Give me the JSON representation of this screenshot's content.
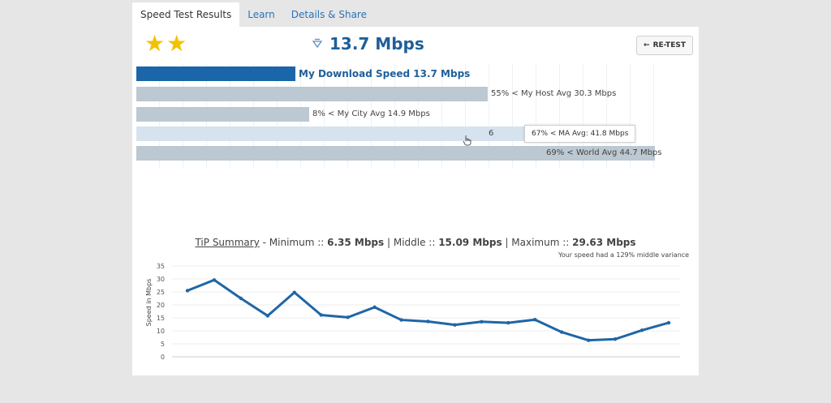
{
  "tabs": [
    {
      "label": "Speed Test Results",
      "active": true
    },
    {
      "label": "Learn",
      "active": false
    },
    {
      "label": "Details & Share",
      "active": false
    }
  ],
  "stars": {
    "count": 2,
    "glyph": "★",
    "color": "#f2c200"
  },
  "header": {
    "speed": "13.7 Mbps",
    "download_icon": "download-arrow-icon",
    "retest_arrow": "←",
    "retest_label": "RE-TEST"
  },
  "bars": [
    {
      "label": "My Download Speed 13.7 Mbps",
      "value": 13.7,
      "color": "#1a66a8",
      "primary": true
    },
    {
      "label": "55% < My Host Avg 30.3 Mbps",
      "value": 30.3,
      "color": "#bcc8d2"
    },
    {
      "label": "8% < My City Avg 14.9 Mbps",
      "value": 14.9,
      "color": "#bcc8d2"
    },
    {
      "label": "6",
      "value": 41.8,
      "color": "#d6e3ee"
    },
    {
      "label": "69% < World Avg 44.7 Mbps",
      "value": 44.7,
      "color": "#bcc8d2"
    }
  ],
  "tooltip": "67% < MA Avg: 41.8 Mbps",
  "summary": {
    "tip_label": "TiP Summary",
    "min_label": " - Minimum :: ",
    "min_value": "6.35 Mbps",
    "mid_label": " | Middle :: ",
    "mid_value": "15.09 Mbps",
    "max_label": " | Maximum :: ",
    "max_value": "29.63 Mbps",
    "variance": "Your speed had a 129% middle variance"
  },
  "chart_data": {
    "type": "line",
    "ylabel": "Speed in Mbps",
    "ylim": [
      0,
      35
    ],
    "yticks": [
      0,
      5,
      10,
      15,
      20,
      25,
      30,
      35
    ],
    "x": [
      1,
      2,
      3,
      4,
      5,
      6,
      7,
      8,
      9,
      10,
      11,
      12,
      13,
      14,
      15,
      16,
      17,
      18,
      19
    ],
    "series": [
      {
        "values": [
          25.5,
          29.6,
          22.5,
          15.8,
          24.8,
          16.1,
          15.2,
          19.1,
          14.2,
          13.6,
          12.3,
          13.5,
          13.1,
          14.3,
          9.5,
          6.35,
          6.8,
          10.2,
          13.1
        ],
        "color": "#1f66a6"
      }
    ],
    "grid": true,
    "legend": "none"
  }
}
